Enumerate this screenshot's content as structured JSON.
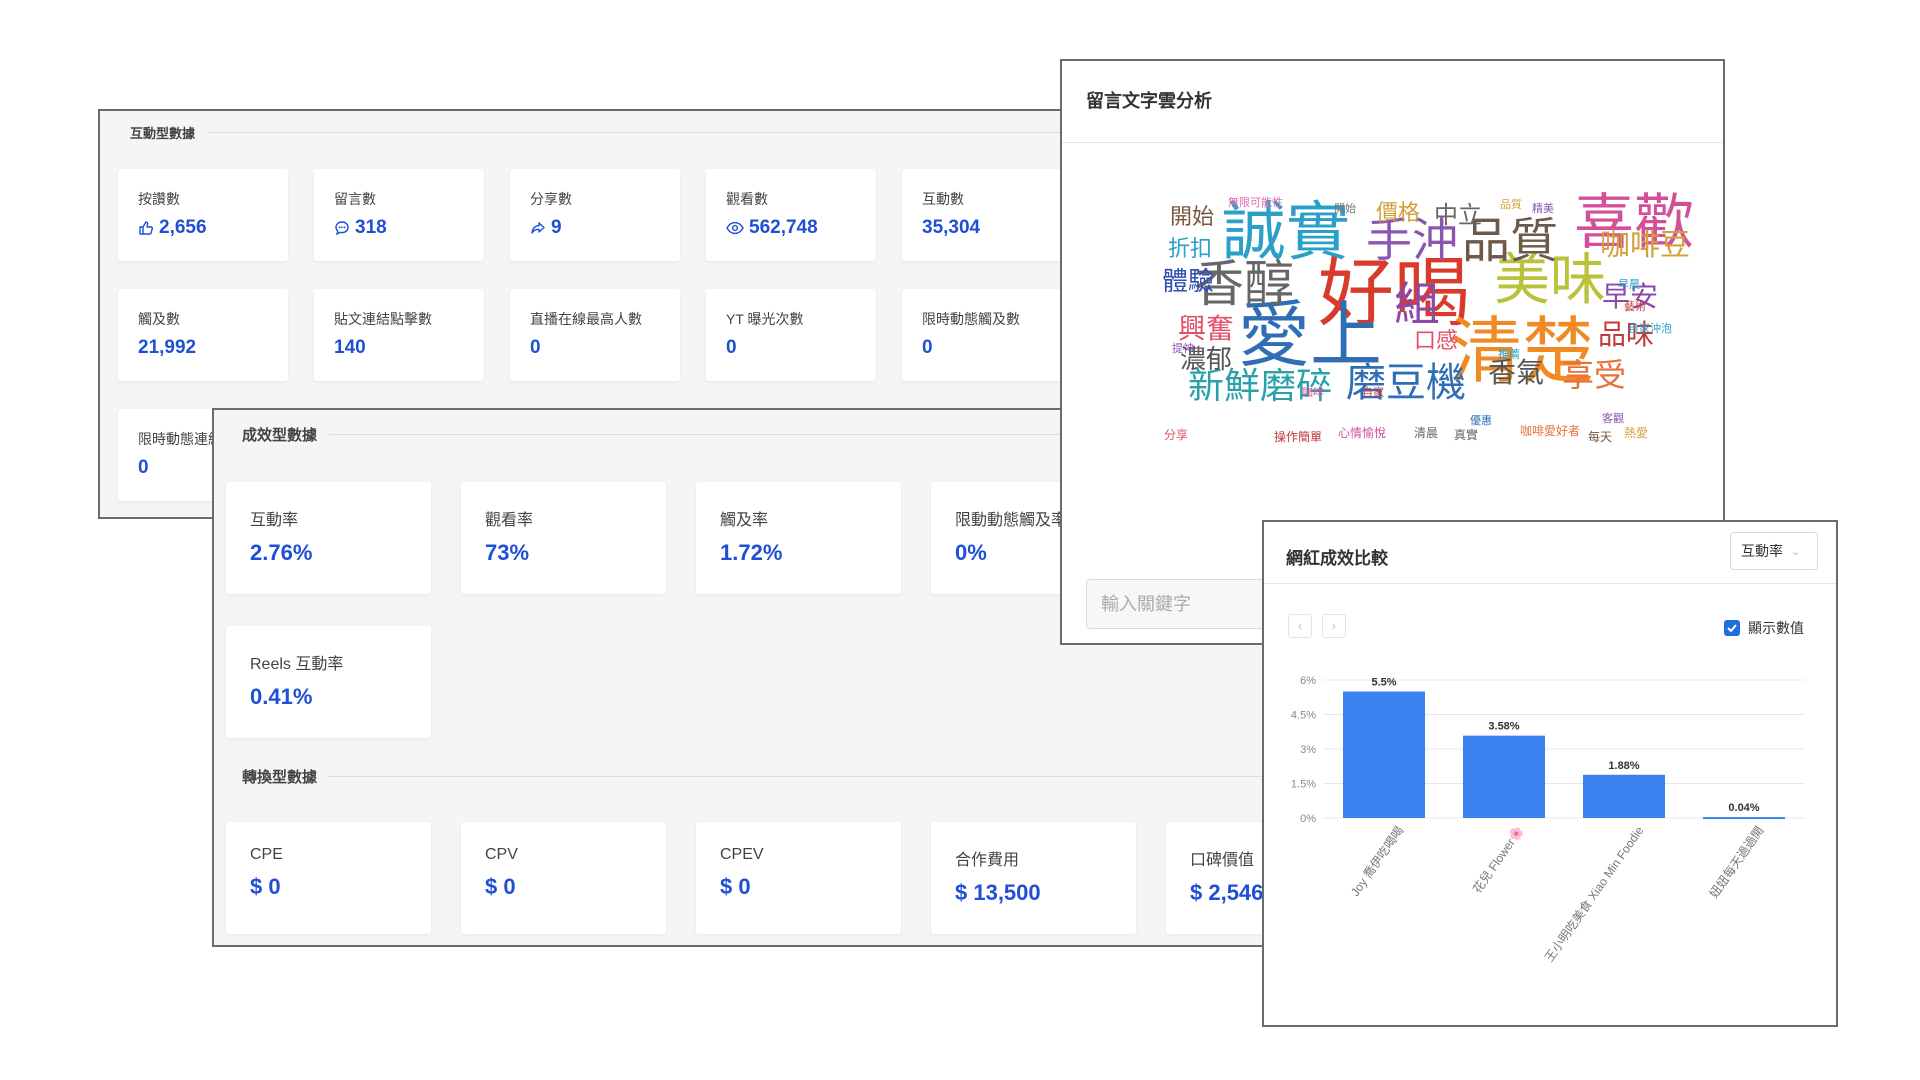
{
  "interaction": {
    "title": "互動型數據",
    "cards": [
      {
        "label": "按讚數",
        "value": "2,656",
        "icon": "thumbs-up-icon"
      },
      {
        "label": "留言數",
        "value": "318",
        "icon": "chat-bubble-icon"
      },
      {
        "label": "分享數",
        "value": "9",
        "icon": "share-arrow-icon"
      },
      {
        "label": "觀看數",
        "value": "562,748",
        "icon": "eye-icon"
      },
      {
        "label": "互動數",
        "value": "35,304"
      },
      {
        "label": "觸及數",
        "value": "21,992"
      },
      {
        "label": "貼文連結點擊數",
        "value": "140"
      },
      {
        "label": "直播在線最高人數",
        "value": "0"
      },
      {
        "label": "YT 曝光次數",
        "value": "0"
      },
      {
        "label": "限時動態觸及數",
        "value": "0"
      },
      {
        "label": "限時動態連結",
        "value": "0"
      }
    ]
  },
  "performance": {
    "title": "成效型數據",
    "cards": [
      {
        "label": "互動率",
        "value": "2.76%"
      },
      {
        "label": "觀看率",
        "value": "73%"
      },
      {
        "label": "觸及率",
        "value": "1.72%"
      },
      {
        "label": "限動動態觸及率",
        "value": "0%"
      },
      {
        "label": "Reels 互動率",
        "value": "0.41%"
      }
    ]
  },
  "conversion": {
    "title": "轉換型數據",
    "cards": [
      {
        "label": "CPE",
        "value": "$ 0"
      },
      {
        "label": "CPV",
        "value": "$ 0"
      },
      {
        "label": "CPEV",
        "value": "$ 0"
      },
      {
        "label": "合作費用",
        "value": "$ 13,500"
      },
      {
        "label": "口碑價值",
        "value": "$ 2,546"
      }
    ]
  },
  "word_cloud": {
    "title": "留言文字雲分析",
    "keyword_placeholder": "輸入關鍵字",
    "words": [
      {
        "text": "好喝",
        "color": "#d93a2b"
      },
      {
        "text": "愛上",
        "color": "#2f6db5"
      },
      {
        "text": "清楚",
        "color": "#f08a24"
      },
      {
        "text": "誠實",
        "color": "#2aa0c8"
      },
      {
        "text": "喜歡",
        "color": "#d44f9a"
      },
      {
        "text": "美味",
        "color": "#b9c23a"
      },
      {
        "text": "香醇",
        "color": "#666666"
      },
      {
        "text": "品質",
        "color": "#6e5a4a"
      },
      {
        "text": "手沖",
        "color": "#8a56b0"
      },
      {
        "text": "組",
        "color": "#8c4aa8"
      },
      {
        "text": "磨豆機",
        "color": "#2f6db5"
      },
      {
        "text": "新鮮磨碎",
        "color": "#2aa0a8"
      },
      {
        "text": "咖啡豆",
        "color": "#d4a03a"
      },
      {
        "text": "興奮",
        "color": "#e24f6a"
      },
      {
        "text": "濃郁",
        "color": "#555555"
      },
      {
        "text": "享受",
        "color": "#e8703a"
      },
      {
        "text": "香氣",
        "color": "#555555"
      },
      {
        "text": "早安",
        "color": "#8c4aa8"
      },
      {
        "text": "品味",
        "color": "#c23a3a"
      },
      {
        "text": "開始",
        "color": "#7a5540"
      },
      {
        "text": "折扣",
        "color": "#2aa0c8"
      },
      {
        "text": "體驗",
        "color": "#2f4fb5"
      },
      {
        "text": "價格",
        "color": "#d4a03a"
      },
      {
        "text": "中立",
        "color": "#666666"
      },
      {
        "text": "口感",
        "color": "#e24f6a"
      },
      {
        "text": "無限可能性",
        "color": "#e06bb0"
      },
      {
        "text": "開始",
        "color": "#777777"
      },
      {
        "text": "品質",
        "color": "#d4a03a"
      },
      {
        "text": "精美",
        "color": "#8a56b0"
      },
      {
        "text": "早晨",
        "color": "#2aa0c8"
      },
      {
        "text": "藝術",
        "color": "#c23a3a"
      },
      {
        "text": "自家沖泡",
        "color": "#2aa0c8"
      },
      {
        "text": "提神",
        "color": "#8a56b0"
      },
      {
        "text": "推薦",
        "color": "#2aa0c8"
      },
      {
        "text": "咖啡",
        "color": "#d44f9a"
      },
      {
        "text": "自家",
        "color": "#c23a3a"
      },
      {
        "text": "客觀",
        "color": "#8a56b0"
      },
      {
        "text": "優惠",
        "color": "#2f6db5"
      },
      {
        "text": "分享",
        "color": "#e24f6a"
      },
      {
        "text": "操作簡單",
        "color": "#c23a3a"
      },
      {
        "text": "心情愉悅",
        "color": "#d44f9a"
      },
      {
        "text": "清晨",
        "color": "#666666"
      },
      {
        "text": "真實",
        "color": "#666666"
      },
      {
        "text": "咖啡愛好者",
        "color": "#e8703a"
      },
      {
        "text": "每天",
        "color": "#7a5540"
      },
      {
        "text": "熱愛",
        "color": "#d4a03a"
      }
    ]
  },
  "comparison": {
    "title": "網紅成效比較",
    "metric_select": "互動率",
    "show_values_label": "顯示數值",
    "chart_data": {
      "type": "bar",
      "categories": [
        "Joy 喬伊吃喝喝",
        "花兒 Flower🌸",
        "王小明吃美食 Xiao Min Foodie",
        "妞妞每天過過開"
      ],
      "values": [
        5.5,
        3.58,
        1.88,
        0.04
      ],
      "value_labels": [
        "5.5%",
        "3.58%",
        "1.88%",
        "0.04%"
      ],
      "ylim": [
        0,
        6
      ],
      "yticks": [
        "0%",
        "1.5%",
        "3%",
        "4.5%",
        "6%"
      ],
      "color": "#3a82ef",
      "grid": true
    }
  }
}
